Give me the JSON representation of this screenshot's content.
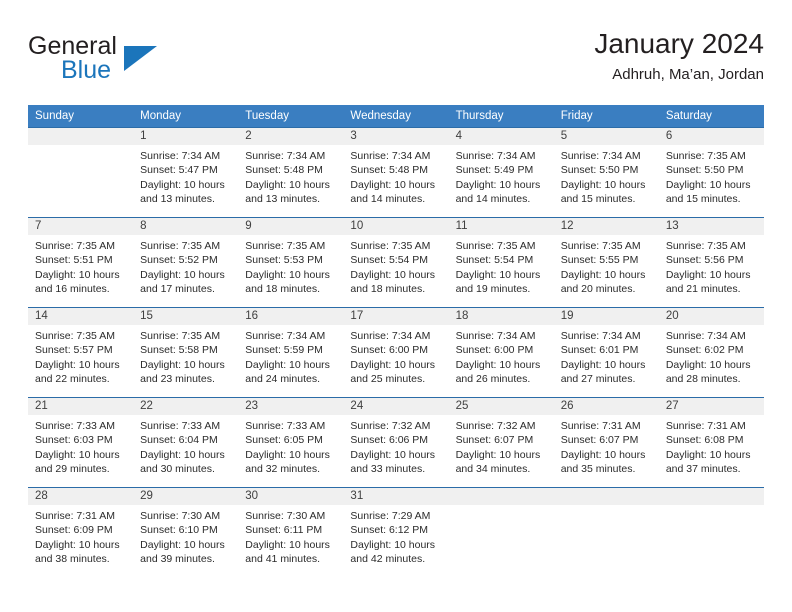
{
  "brand": {
    "name_top": "General",
    "name_bottom": "Blue",
    "accent_color": "#1b75bb"
  },
  "header": {
    "title": "January 2024",
    "subtitle": "Adhruh, Ma’an, Jordan"
  },
  "theme": {
    "header_blue": "#3a7ec1",
    "rule_blue": "#2b6ca8",
    "band_gray": "#f0f0f0"
  },
  "weekday_headers": [
    "Sunday",
    "Monday",
    "Tuesday",
    "Wednesday",
    "Thursday",
    "Friday",
    "Saturday"
  ],
  "weeks": [
    [
      {
        "day": "",
        "lines": []
      },
      {
        "day": "1",
        "lines": [
          "Sunrise: 7:34 AM",
          "Sunset: 5:47 PM",
          "Daylight: 10 hours",
          "and 13 minutes."
        ]
      },
      {
        "day": "2",
        "lines": [
          "Sunrise: 7:34 AM",
          "Sunset: 5:48 PM",
          "Daylight: 10 hours",
          "and 13 minutes."
        ]
      },
      {
        "day": "3",
        "lines": [
          "Sunrise: 7:34 AM",
          "Sunset: 5:48 PM",
          "Daylight: 10 hours",
          "and 14 minutes."
        ]
      },
      {
        "day": "4",
        "lines": [
          "Sunrise: 7:34 AM",
          "Sunset: 5:49 PM",
          "Daylight: 10 hours",
          "and 14 minutes."
        ]
      },
      {
        "day": "5",
        "lines": [
          "Sunrise: 7:34 AM",
          "Sunset: 5:50 PM",
          "Daylight: 10 hours",
          "and 15 minutes."
        ]
      },
      {
        "day": "6",
        "lines": [
          "Sunrise: 7:35 AM",
          "Sunset: 5:50 PM",
          "Daylight: 10 hours",
          "and 15 minutes."
        ]
      }
    ],
    [
      {
        "day": "7",
        "lines": [
          "Sunrise: 7:35 AM",
          "Sunset: 5:51 PM",
          "Daylight: 10 hours",
          "and 16 minutes."
        ]
      },
      {
        "day": "8",
        "lines": [
          "Sunrise: 7:35 AM",
          "Sunset: 5:52 PM",
          "Daylight: 10 hours",
          "and 17 minutes."
        ]
      },
      {
        "day": "9",
        "lines": [
          "Sunrise: 7:35 AM",
          "Sunset: 5:53 PM",
          "Daylight: 10 hours",
          "and 18 minutes."
        ]
      },
      {
        "day": "10",
        "lines": [
          "Sunrise: 7:35 AM",
          "Sunset: 5:54 PM",
          "Daylight: 10 hours",
          "and 18 minutes."
        ]
      },
      {
        "day": "11",
        "lines": [
          "Sunrise: 7:35 AM",
          "Sunset: 5:54 PM",
          "Daylight: 10 hours",
          "and 19 minutes."
        ]
      },
      {
        "day": "12",
        "lines": [
          "Sunrise: 7:35 AM",
          "Sunset: 5:55 PM",
          "Daylight: 10 hours",
          "and 20 minutes."
        ]
      },
      {
        "day": "13",
        "lines": [
          "Sunrise: 7:35 AM",
          "Sunset: 5:56 PM",
          "Daylight: 10 hours",
          "and 21 minutes."
        ]
      }
    ],
    [
      {
        "day": "14",
        "lines": [
          "Sunrise: 7:35 AM",
          "Sunset: 5:57 PM",
          "Daylight: 10 hours",
          "and 22 minutes."
        ]
      },
      {
        "day": "15",
        "lines": [
          "Sunrise: 7:35 AM",
          "Sunset: 5:58 PM",
          "Daylight: 10 hours",
          "and 23 minutes."
        ]
      },
      {
        "day": "16",
        "lines": [
          "Sunrise: 7:34 AM",
          "Sunset: 5:59 PM",
          "Daylight: 10 hours",
          "and 24 minutes."
        ]
      },
      {
        "day": "17",
        "lines": [
          "Sunrise: 7:34 AM",
          "Sunset: 6:00 PM",
          "Daylight: 10 hours",
          "and 25 minutes."
        ]
      },
      {
        "day": "18",
        "lines": [
          "Sunrise: 7:34 AM",
          "Sunset: 6:00 PM",
          "Daylight: 10 hours",
          "and 26 minutes."
        ]
      },
      {
        "day": "19",
        "lines": [
          "Sunrise: 7:34 AM",
          "Sunset: 6:01 PM",
          "Daylight: 10 hours",
          "and 27 minutes."
        ]
      },
      {
        "day": "20",
        "lines": [
          "Sunrise: 7:34 AM",
          "Sunset: 6:02 PM",
          "Daylight: 10 hours",
          "and 28 minutes."
        ]
      }
    ],
    [
      {
        "day": "21",
        "lines": [
          "Sunrise: 7:33 AM",
          "Sunset: 6:03 PM",
          "Daylight: 10 hours",
          "and 29 minutes."
        ]
      },
      {
        "day": "22",
        "lines": [
          "Sunrise: 7:33 AM",
          "Sunset: 6:04 PM",
          "Daylight: 10 hours",
          "and 30 minutes."
        ]
      },
      {
        "day": "23",
        "lines": [
          "Sunrise: 7:33 AM",
          "Sunset: 6:05 PM",
          "Daylight: 10 hours",
          "and 32 minutes."
        ]
      },
      {
        "day": "24",
        "lines": [
          "Sunrise: 7:32 AM",
          "Sunset: 6:06 PM",
          "Daylight: 10 hours",
          "and 33 minutes."
        ]
      },
      {
        "day": "25",
        "lines": [
          "Sunrise: 7:32 AM",
          "Sunset: 6:07 PM",
          "Daylight: 10 hours",
          "and 34 minutes."
        ]
      },
      {
        "day": "26",
        "lines": [
          "Sunrise: 7:31 AM",
          "Sunset: 6:07 PM",
          "Daylight: 10 hours",
          "and 35 minutes."
        ]
      },
      {
        "day": "27",
        "lines": [
          "Sunrise: 7:31 AM",
          "Sunset: 6:08 PM",
          "Daylight: 10 hours",
          "and 37 minutes."
        ]
      }
    ],
    [
      {
        "day": "28",
        "lines": [
          "Sunrise: 7:31 AM",
          "Sunset: 6:09 PM",
          "Daylight: 10 hours",
          "and 38 minutes."
        ]
      },
      {
        "day": "29",
        "lines": [
          "Sunrise: 7:30 AM",
          "Sunset: 6:10 PM",
          "Daylight: 10 hours",
          "and 39 minutes."
        ]
      },
      {
        "day": "30",
        "lines": [
          "Sunrise: 7:30 AM",
          "Sunset: 6:11 PM",
          "Daylight: 10 hours",
          "and 41 minutes."
        ]
      },
      {
        "day": "31",
        "lines": [
          "Sunrise: 7:29 AM",
          "Sunset: 6:12 PM",
          "Daylight: 10 hours",
          "and 42 minutes."
        ]
      },
      {
        "day": "",
        "lines": []
      },
      {
        "day": "",
        "lines": []
      },
      {
        "day": "",
        "lines": []
      }
    ]
  ]
}
